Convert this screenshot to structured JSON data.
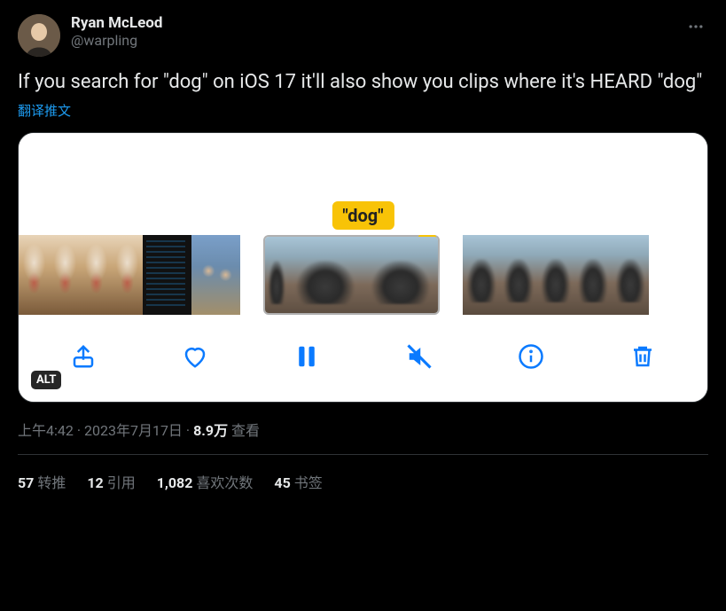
{
  "author": {
    "display_name": "Ryan McLeod",
    "handle": "@warpling"
  },
  "body": "If you search for \"dog\" on iOS 17 it'll also show you clips where it's HEARD \"dog\"",
  "translate_label": "翻译推文",
  "media": {
    "highlight_label": "\"dog\"",
    "alt_badge": "ALT",
    "toolbar": {
      "share": "share",
      "like": "like",
      "pause": "pause",
      "mute": "mute",
      "info": "info",
      "delete": "delete"
    }
  },
  "meta": {
    "time": "上午4:42",
    "date": "2023年7月17日",
    "views_num": "8.9万",
    "views_label": "查看",
    "sep": " · "
  },
  "stats": {
    "retweets_num": "57",
    "retweets_label": "转推",
    "quotes_num": "12",
    "quotes_label": "引用",
    "likes_num": "1,082",
    "likes_label": "喜欢次数",
    "bookmarks_num": "45",
    "bookmarks_label": "书签"
  }
}
